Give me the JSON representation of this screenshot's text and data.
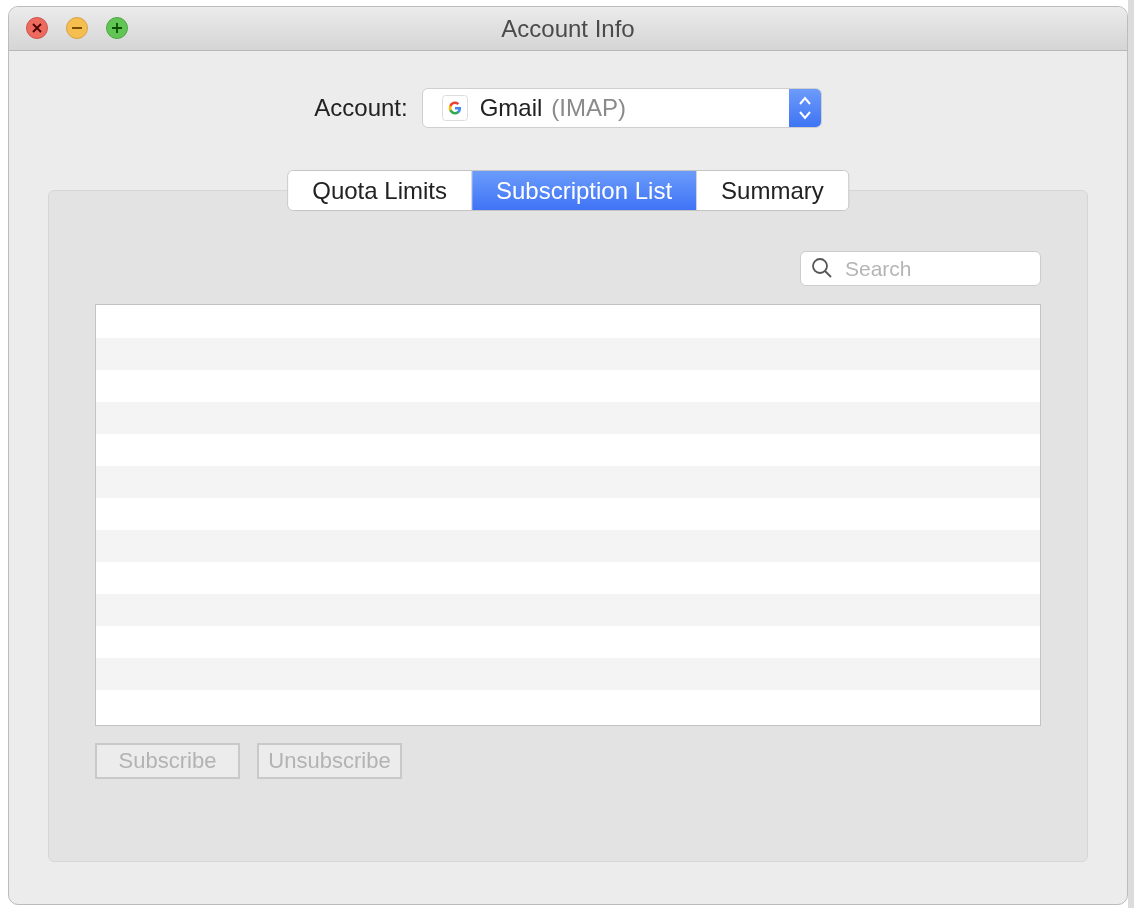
{
  "window": {
    "title": "Account Info"
  },
  "account": {
    "label": "Account:",
    "name": "Gmail",
    "type": "(IMAP)"
  },
  "tabs": [
    {
      "label": "Quota Limits",
      "selected": false
    },
    {
      "label": "Subscription List",
      "selected": true
    },
    {
      "label": "Summary",
      "selected": false
    }
  ],
  "search": {
    "placeholder": "Search"
  },
  "buttons": [
    {
      "label": "Subscribe",
      "disabled": true
    },
    {
      "label": "Unsubscribe",
      "disabled": true
    }
  ]
}
